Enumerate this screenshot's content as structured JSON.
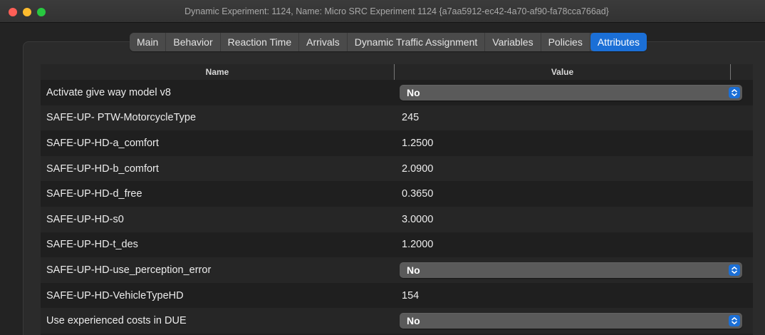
{
  "window": {
    "title": "Dynamic Experiment: 1124, Name: Micro SRC Experiment 1124  {a7aa5912-ec42-4a70-af90-fa78cca766ad}"
  },
  "tabs": [
    {
      "label": "Main",
      "active": false
    },
    {
      "label": "Behavior",
      "active": false
    },
    {
      "label": "Reaction Time",
      "active": false
    },
    {
      "label": "Arrivals",
      "active": false
    },
    {
      "label": "Dynamic Traffic Assignment",
      "active": false
    },
    {
      "label": "Variables",
      "active": false
    },
    {
      "label": "Policies",
      "active": false
    },
    {
      "label": "Attributes",
      "active": true
    }
  ],
  "table": {
    "headers": {
      "name": "Name",
      "value": "Value"
    },
    "rows": [
      {
        "name": "Activate give way model v8",
        "value": "No",
        "type": "dropdown"
      },
      {
        "name": "SAFE-UP- PTW-MotorcycleType",
        "value": "245",
        "type": "text"
      },
      {
        "name": "SAFE-UP-HD-a_comfort",
        "value": "1.2500",
        "type": "text"
      },
      {
        "name": "SAFE-UP-HD-b_comfort",
        "value": "2.0900",
        "type": "text"
      },
      {
        "name": "SAFE-UP-HD-d_free",
        "value": "0.3650",
        "type": "text"
      },
      {
        "name": "SAFE-UP-HD-s0",
        "value": "3.0000",
        "type": "text"
      },
      {
        "name": "SAFE-UP-HD-t_des",
        "value": "1.2000",
        "type": "text"
      },
      {
        "name": "SAFE-UP-HD-use_perception_error",
        "value": "No",
        "type": "dropdown"
      },
      {
        "name": "SAFE-UP-HD-VehicleTypeHD",
        "value": "154",
        "type": "text"
      },
      {
        "name": "Use experienced costs in DUE",
        "value": "No",
        "type": "dropdown"
      }
    ]
  },
  "colors": {
    "accent": "#1b6fd6",
    "close": "#fe5f57",
    "minimize": "#febc2e",
    "maximize": "#28c840"
  },
  "icons": {
    "dropdown": "chevron-updown-icon"
  }
}
